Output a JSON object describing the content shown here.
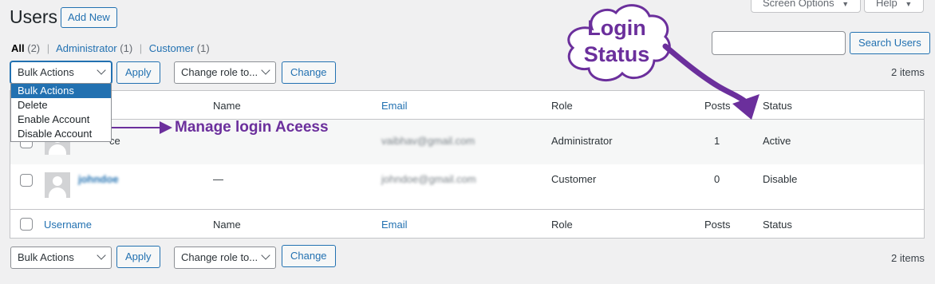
{
  "header": {
    "title": "Users",
    "add_new": "Add New",
    "screen_options": "Screen Options",
    "help": "Help"
  },
  "filters": {
    "all_label": "All",
    "all_count": "(2)",
    "admin_label": "Administrator",
    "admin_count": "(1)",
    "customer_label": "Customer",
    "customer_count": "(1)",
    "separator": "|"
  },
  "search": {
    "value": "",
    "button": "Search Users"
  },
  "top_actions": {
    "bulk_select": "Bulk Actions",
    "apply": "Apply",
    "role_select": "Change role to...",
    "change": "Change",
    "items_count": "2 items"
  },
  "bulk_dropdown": {
    "options": [
      "Bulk Actions",
      "Delete",
      "Enable Account",
      "Disable Account"
    ],
    "selected_index": 0
  },
  "table": {
    "columns": [
      "Username",
      "Name",
      "Email",
      "Role",
      "Posts",
      "Status"
    ],
    "rows": [
      {
        "username": "ce",
        "name": "",
        "email": "vaibhav@gmail.com",
        "role": "Administrator",
        "posts": "1",
        "status": "Active"
      },
      {
        "username": "johndoe",
        "name": "—",
        "email": "johndoe@gmail.com",
        "role": "Customer",
        "posts": "0",
        "status": "Disable"
      }
    ]
  },
  "bottom_actions": {
    "bulk_select": "Bulk Actions",
    "apply": "Apply",
    "role_select": "Change role to...",
    "change": "Change",
    "items_count": "2 items"
  },
  "annotations": {
    "arrow_label": "Manage login Aceess",
    "cloud_line1": "Login",
    "cloud_line2": "Status",
    "color": "#6b2f9c"
  },
  "colors": {
    "accent": "#2271b1",
    "background": "#f0f0f1"
  },
  "icons": {
    "dropdown": "chevron-down-icon",
    "user": "avatar-placeholder-icon"
  }
}
